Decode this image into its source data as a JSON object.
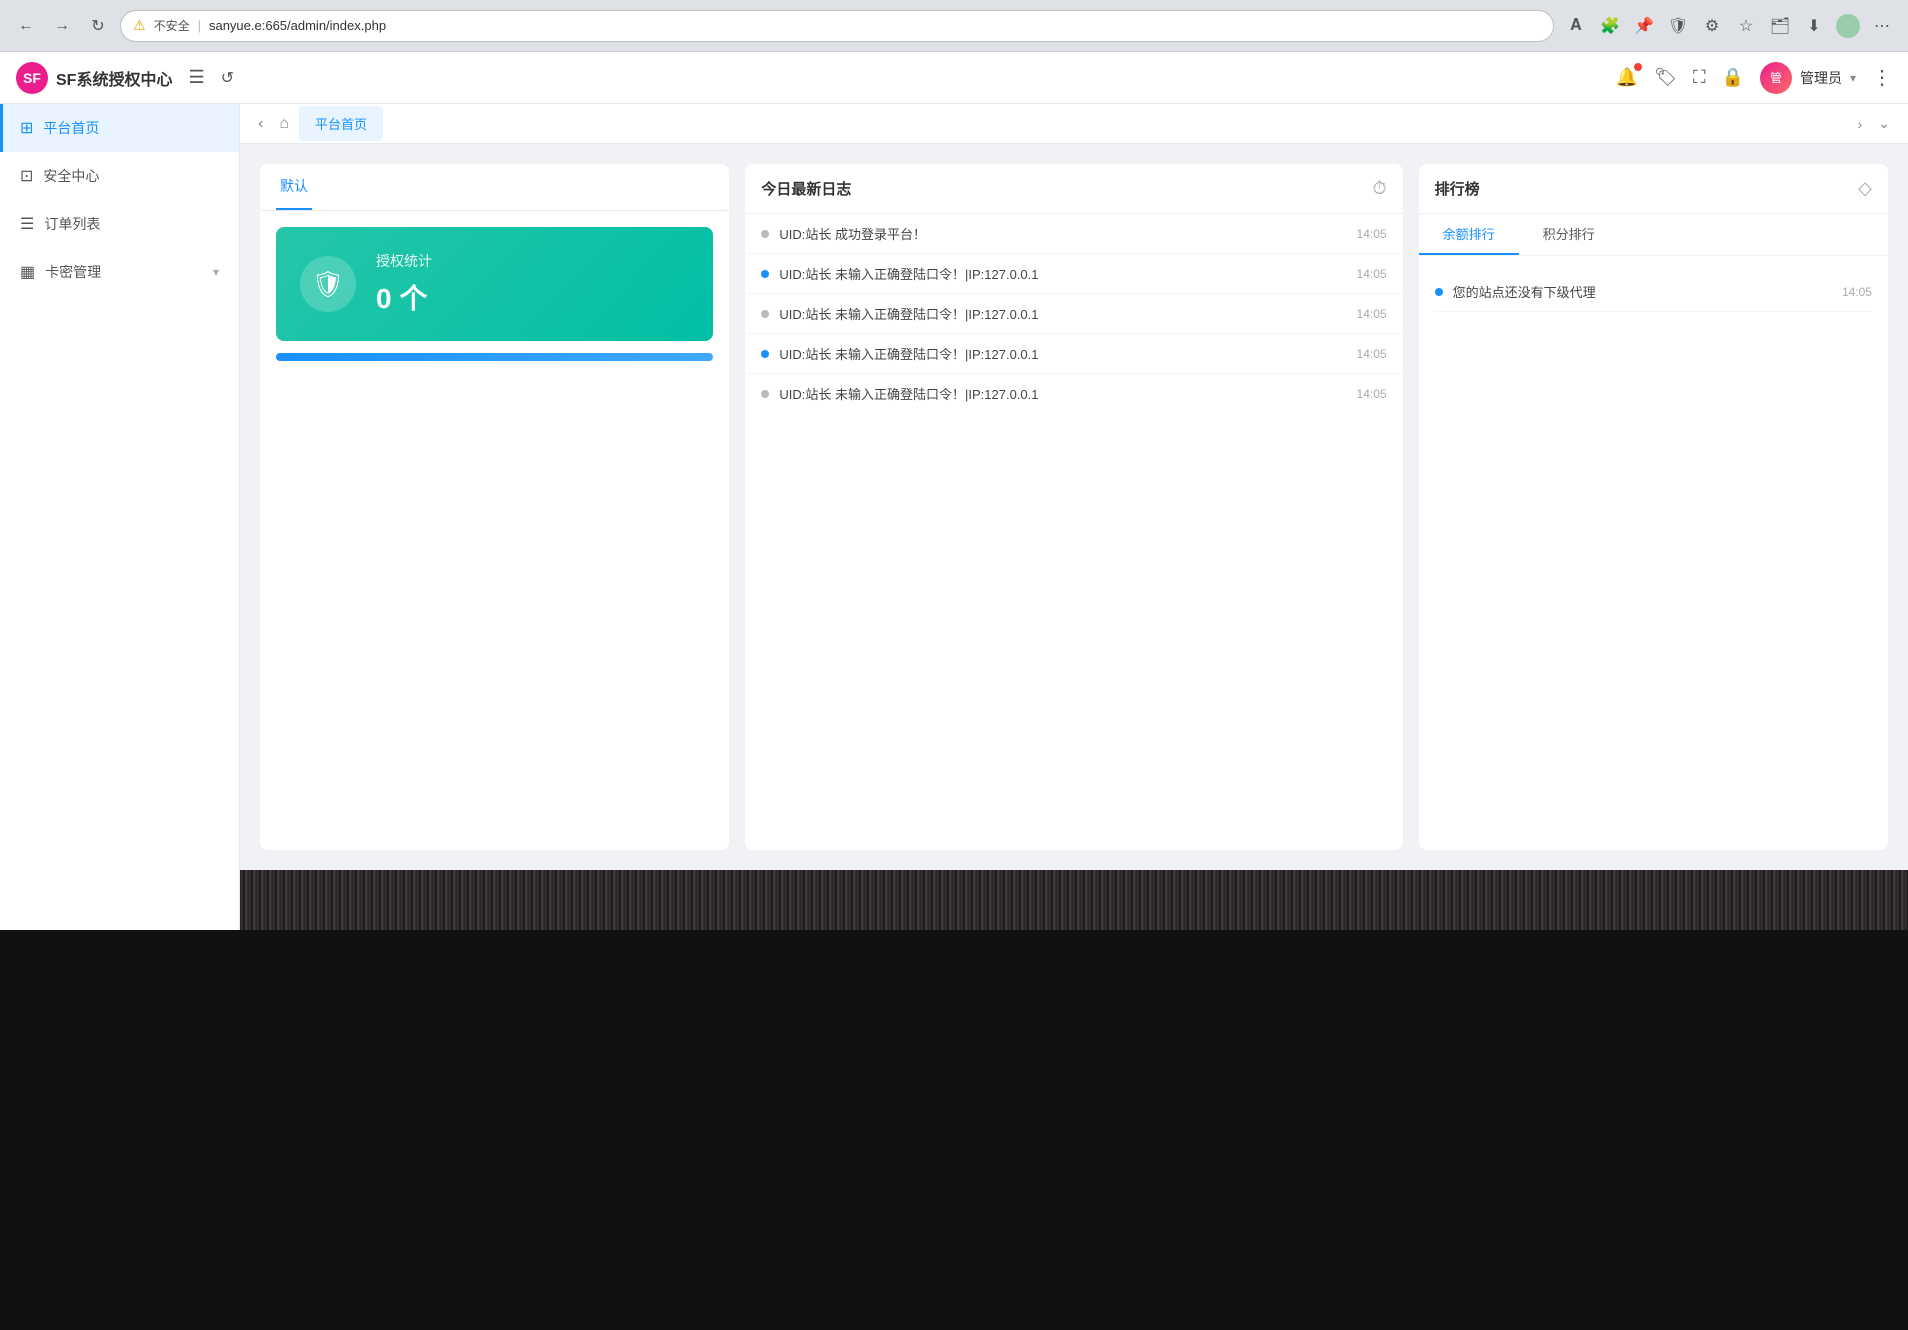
{
  "browser": {
    "back_label": "←",
    "forward_label": "→",
    "refresh_label": "↻",
    "not_secure": "不安全",
    "url": "sanyue.e:665/admin/index.php",
    "more_label": "⋯"
  },
  "header": {
    "logo_text": "SF",
    "app_title": "SF系统授权中心",
    "menu_icon": "☰",
    "refresh_icon": "↺",
    "bell_icon": "🔔",
    "tag_icon": "🏷",
    "fullscreen_icon": "⛶",
    "lock_icon": "🔒",
    "username": "管理员",
    "more_icon": "⋮"
  },
  "sidebar": {
    "items": [
      {
        "id": "home",
        "label": "平台首页",
        "icon": "⊞",
        "active": true
      },
      {
        "id": "security",
        "label": "安全中心",
        "icon": "⊡",
        "active": false
      },
      {
        "id": "orders",
        "label": "订单列表",
        "icon": "☰",
        "active": false
      },
      {
        "id": "cards",
        "label": "卡密管理",
        "icon": "▦",
        "active": false,
        "has_arrow": true
      }
    ]
  },
  "tabs": {
    "nav_back": "‹",
    "nav_forward": "›",
    "nav_expand": "⌄",
    "items": [
      {
        "label": "平台首页",
        "active": true,
        "home_icon": "⌂"
      }
    ]
  },
  "panel": {
    "tabs": [
      {
        "label": "默认",
        "active": true
      }
    ]
  },
  "stat_card": {
    "icon": "🛡",
    "label": "授权统计",
    "value": "0 个"
  },
  "log_panel": {
    "title": "今日最新日志",
    "clock_icon": "⏱",
    "items": [
      {
        "dot": "gray",
        "text": "UID:站长 成功登录平台！",
        "time": "14:05"
      },
      {
        "dot": "blue",
        "text": "UID:站长 未输入正确登陆口令！|IP:127.0.0.1",
        "time": "14:05"
      },
      {
        "dot": "gray",
        "text": "UID:站长 未输入正确登陆口令！|IP:127.0.0.1",
        "time": "14:05"
      },
      {
        "dot": "blue",
        "text": "UID:站长 未输入正确登陆口令！|IP:127.0.0.1",
        "time": "14:05"
      },
      {
        "dot": "gray",
        "text": "UID:站长 未输入正确登陆口令！|IP:127.0.0.1",
        "time": "14:05"
      }
    ]
  },
  "rank_panel": {
    "title": "排行榜",
    "diamond_icon": "◇",
    "tabs": [
      {
        "label": "余额排行",
        "active": true
      },
      {
        "label": "积分排行",
        "active": false
      }
    ],
    "items": [
      {
        "dot": "blue",
        "text": "您的站点还没有下级代理",
        "time": "14:05"
      }
    ]
  }
}
